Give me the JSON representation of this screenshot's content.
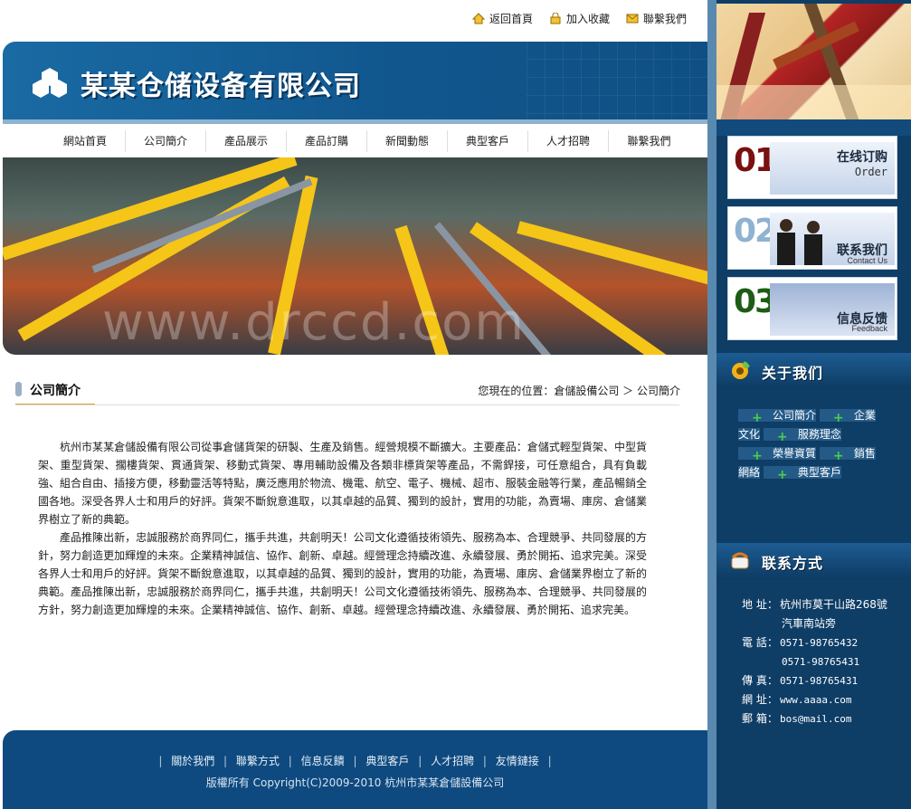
{
  "top_links": [
    {
      "label": "返回首頁",
      "icon": "home-icon"
    },
    {
      "label": "加入收藏",
      "icon": "lock-icon"
    },
    {
      "label": "聯繫我們",
      "icon": "mail-icon"
    }
  ],
  "header": {
    "company_name": "某某仓储设备有限公司"
  },
  "nav": [
    {
      "label": "網站首頁"
    },
    {
      "label": "公司簡介"
    },
    {
      "label": "產品展示"
    },
    {
      "label": "產品訂購"
    },
    {
      "label": "新聞動態"
    },
    {
      "label": "典型客戶"
    },
    {
      "label": "人才招聘"
    },
    {
      "label": "聯繫我們"
    }
  ],
  "banner": {
    "watermark": "www.drccd.com"
  },
  "section": {
    "title": "公司簡介",
    "breadcrumb": "您現在的位置：倉儲設備公司 ＞ 公司簡介"
  },
  "content": {
    "paragraphs": [
      "杭州市某某倉儲設備有限公司從事倉儲貨架的研製、生產及銷售。經營規模不斷擴大。主要產品：倉儲式輕型貨架、中型貨架、重型貨架、擱樓貨架、貫通貨架、移動式貨架、專用輔助設備及各類非標貨架等產品，不需銲接，可任意組合，具有負載強、組合自由、插接方便，移動靈活等特點，廣泛應用於物流、機電、航空、電子、機械、超市、服裝金融等行業，產品暢銷全國各地。深受各界人士和用戶的好評。貨架不斷銳意進取，以其卓越的品質、獨到的設計，實用的功能，為賣場、庫房、倉儲業界樹立了新的典範。",
      "產品推陳出新，忠誠服務於商界同仁，攜手共進，共創明天！公司文化遵循技術領先、服務為本、合理競爭、共同發展的方針，努力創造更加輝煌的未來。企業精神誠信、協作、創新、卓越。經營理念持續改進、永續發展、勇於開拓、追求完美。深受各界人士和用戶的好評。貨架不斷銳意進取，以其卓越的品質、獨到的設計，實用的功能，為賣場、庫房、倉儲業界樹立了新的典範。產品推陳出新，忠誠服務於商界同仁，攜手共進，共創明天！公司文化遵循技術領先、服務為本、合理競爭、共同發展的方針，努力創造更加輝煌的未來。企業精神誠信、協作、創新、卓越。經營理念持續改進、永續發展、勇於開拓、追求完美。"
    ]
  },
  "promos": [
    {
      "num": "01",
      "title": "在线订购",
      "sub": "Order",
      "num_color": "#7a1010"
    },
    {
      "num": "02",
      "title": "联系我们",
      "sub": "Contact Us",
      "num_color": "#8fb2d0"
    },
    {
      "num": "03",
      "title": "信息反馈",
      "sub": "Feedback",
      "num_color": "#1d5c14"
    }
  ],
  "about": {
    "heading": "关于我们",
    "items": [
      "公司簡介",
      "企業文化",
      "服務理念",
      "榮譽資質",
      "銷售網絡",
      "典型客戶"
    ]
  },
  "contact": {
    "heading": "联系方式",
    "address_label": "地 址：",
    "address_line1": "杭州市莫干山路268號",
    "address_line2": "汽車南站旁",
    "phone_label": "電 話：",
    "phone1": "0571-98765432",
    "phone2": "0571-98765431",
    "fax_label": "傳 真：",
    "fax": "0571-98765431",
    "web_label": "網 址：",
    "web": "www.aaaa.com",
    "email_label": "郵 箱：",
    "email": "bos@mail.com"
  },
  "footer": {
    "links": [
      "關於我們",
      "聯繫方式",
      "信息反饋",
      "典型客戶",
      "人才招聘",
      "友情鏈接"
    ],
    "copyright": "版權所有 Copyright(C)2009-2010 杭州市某某倉儲設備公司"
  }
}
